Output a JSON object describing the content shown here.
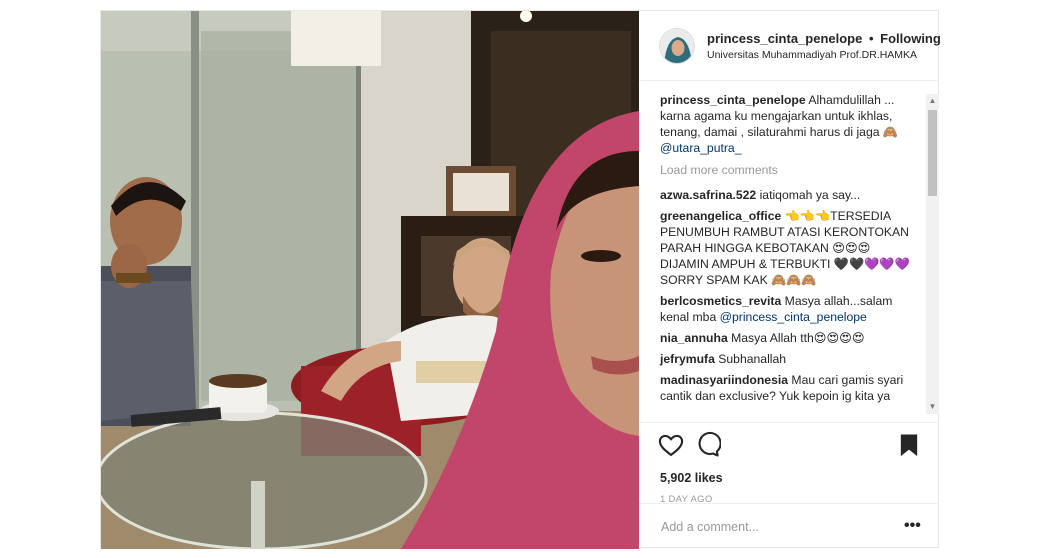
{
  "post": {
    "username": "princess_cinta_penelope",
    "separator": "•",
    "follow_status": "Following",
    "location": "Universitas Muhammadiyah Prof.DR.HAMKA"
  },
  "comments": {
    "caption": {
      "user": "princess_cinta_penelope",
      "text": "Alhamdulillah ... karna agama ku mengajarkan untuk ikhlas, tenang, damai , silaturahmi harus di jaga 🙈",
      "mention": "@utara_putra_"
    },
    "load_more_label": "Load more comments",
    "items": [
      {
        "user": "azwa.safrina.522",
        "text": "iatiqomah ya say..."
      },
      {
        "user": "greenangelica_office",
        "text": "👈👈👈TERSEDIA PENUMBUH RAMBUT ATASI KERONTOKAN PARAH HINGGA KEBOTAKAN 😍😍😍 DIJAMIN AMPUH & TERBUKTI 🖤🖤💜💜💜 SORRY SPAM KAK 🙈🙈🙈"
      },
      {
        "user": "berlcosmetics_revita",
        "text": "Masya allah...salam kenal mba",
        "mention": "@princess_cinta_penelope"
      },
      {
        "user": "nia_annuha",
        "text": "Masya Allah tth😍😍😍😍"
      },
      {
        "user": "jefrymufa",
        "text": "Subhanallah"
      },
      {
        "user": "madinasyariindonesia",
        "text": "Mau cari gamis syari cantik dan exclusive? Yuk kepoin ig kita ya"
      }
    ]
  },
  "stats": {
    "likes": "5,902 likes",
    "time_ago": "1 DAY AGO"
  },
  "add_comment": {
    "placeholder": "Add a comment..."
  },
  "more_options_label": "•••",
  "icons": {
    "like": "heart-icon",
    "comment": "speech-bubble-icon",
    "save": "bookmark-icon",
    "scroll_up": "▲",
    "scroll_down": "▼"
  },
  "colors": {
    "text": "#262626",
    "muted": "#999999",
    "mention": "#003569",
    "border": "#e6e6e6",
    "hijab": "#c94a6e"
  }
}
